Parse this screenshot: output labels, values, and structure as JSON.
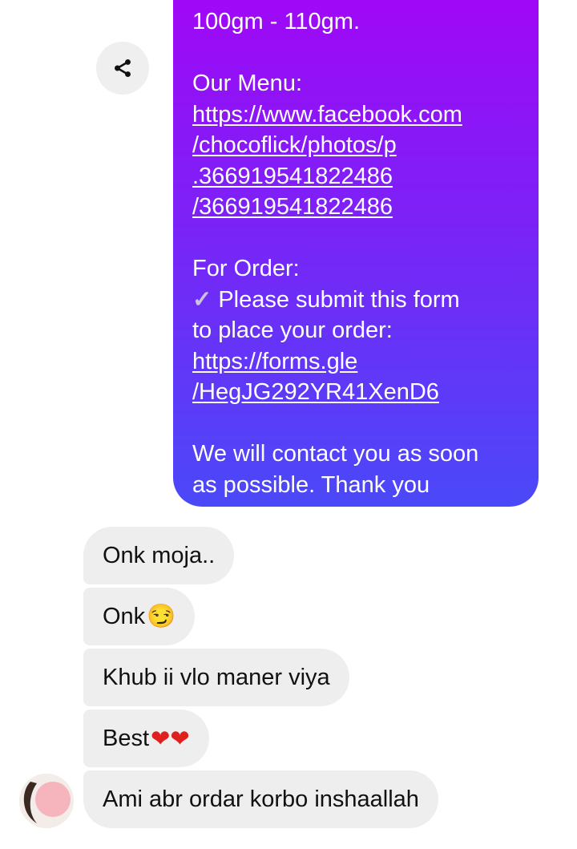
{
  "share": {
    "icon": "share-icon"
  },
  "sent": {
    "line_weight": "100gm - 110gm.",
    "menu_label": "Our Menu:",
    "menu_link": [
      "https://www.facebook.com",
      "/chocoflick/photos/p",
      ".366919541822486",
      "/366919541822486"
    ],
    "order_label": "For Order:",
    "order_line1": "Please submit this form",
    "order_line2": "to place your order:",
    "form_link": [
      "https://forms.gle",
      "/HegJG292YR41XenD6"
    ],
    "closing_line1": "We will contact you as soon",
    "closing_line2": "as possible. Thank you"
  },
  "received": [
    {
      "text": "Onk moja.."
    },
    {
      "text": "Onk",
      "emoji": "😏"
    },
    {
      "text": "Khub ii vlo maner viya"
    },
    {
      "text": "Best",
      "emoji": "❤❤"
    },
    {
      "text": "Ami abr ordar korbo inshaallah"
    }
  ],
  "colors": {
    "sent_top": "#a404f6",
    "sent_bottom": "#4a49f8",
    "received_bg": "#eeeeee"
  }
}
